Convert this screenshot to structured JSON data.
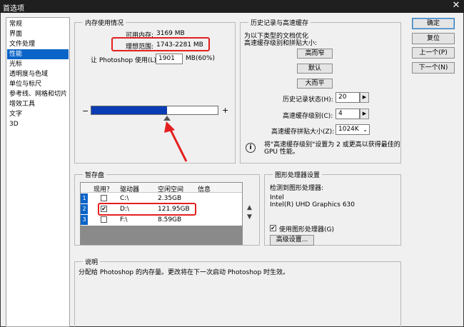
{
  "window": {
    "title": "首选项",
    "close_glyph": "✕"
  },
  "sidebar": {
    "items": [
      {
        "label": "常规"
      },
      {
        "label": "界面"
      },
      {
        "label": "文件处理"
      },
      {
        "label": "性能"
      },
      {
        "label": "光标"
      },
      {
        "label": "透明度与色域"
      },
      {
        "label": "单位与标尺"
      },
      {
        "label": "参考线、网格和切片"
      },
      {
        "label": "增效工具"
      },
      {
        "label": "文字"
      },
      {
        "label": "3D"
      }
    ],
    "selected_index": 3
  },
  "buttons": {
    "ok": "确定",
    "reset": "复位",
    "prev": "上一个(P)",
    "next": "下一个(N)"
  },
  "memory": {
    "title": "内存使用情况",
    "available_label": "可用内存:",
    "available_value": "3169 MB",
    "ideal_label": "理想范围:",
    "ideal_value": "1743-2281 MB",
    "let_label": "让 Photoshop 使用(L):",
    "use_value": "1901",
    "use_suffix": "MB(60%)",
    "minus": "−",
    "plus": "+",
    "slider_fraction": 0.6
  },
  "history": {
    "title": "历史记录与高速缓存",
    "optimize_line1": "为以下类型的文档优化",
    "optimize_line2": "高速缓存级别和拼贴大小:",
    "btn_tall_thin": "高而窄",
    "btn_default": "默认",
    "btn_big_flat": "大而平",
    "states_label": "历史记录状态(H):",
    "states_value": "20",
    "levels_label": "高速缓存级别(C):",
    "levels_value": "4",
    "tile_label": "高速缓存拼贴大小(Z):",
    "tile_value": "1024K",
    "info_line1": "将\"高速缓存级别\"设置为 2 或更高以获得最佳的",
    "info_line2": "GPU 性能。"
  },
  "scratch": {
    "title": "暂存盘",
    "headers": [
      "现用？",
      "驱动器",
      "空闲空间",
      "信息"
    ],
    "rows": [
      {
        "num": "1",
        "active": "",
        "drive": "C:\\",
        "free": "2.35GB",
        "info": ""
      },
      {
        "num": "2",
        "active": "✔",
        "drive": "D:\\",
        "free": "121.95GB",
        "info": ""
      },
      {
        "num": "3",
        "active": "",
        "drive": "F:\\",
        "free": "8.59GB",
        "info": ""
      }
    ],
    "up_arrow": "▲",
    "down_arrow": "▼"
  },
  "gpu": {
    "title": "图形处理器设置",
    "detected_label": "检测到图形处理器:",
    "vendor": "Intel",
    "model": "Intel(R) UHD Graphics 630",
    "use_gpu_label": "使用图形处理器(G)",
    "use_gpu_check": "✔",
    "advanced_btn": "高级设置..."
  },
  "description": {
    "title": "说明",
    "text": "分配给 Photoshop 的内存量。更改将在下一次启动 Photoshop 时生效。"
  },
  "colors": {
    "accent": "#0a64c8",
    "annotation_red": "#e41f1f",
    "slider_fill": "#0a3cb4"
  }
}
